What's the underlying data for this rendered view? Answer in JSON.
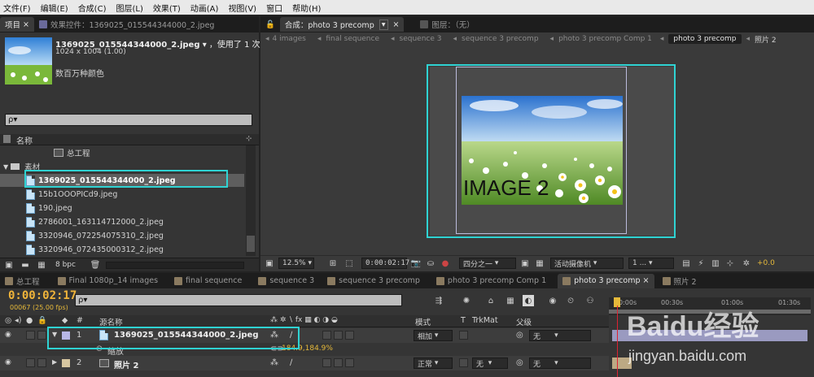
{
  "menu": [
    "文件(F)",
    "编辑(E)",
    "合成(C)",
    "图层(L)",
    "效果(T)",
    "动画(A)",
    "视图(V)",
    "窗口",
    "帮助(H)"
  ],
  "left_tabs": {
    "project": "项目",
    "close": "×",
    "effects": "效果控件：1369025_015544344000_2.jpeg"
  },
  "project": {
    "asset_name": "1369025_015544344000_2.jpeg",
    "dropdown": "▾",
    "used": "，使用了 1 次",
    "dims": "1024 x 1004 (1.00)",
    "colors": "数百万种颜色",
    "search_placeholder": "ρ▾",
    "col_name": "名称",
    "items": [
      {
        "label": "总工程",
        "type": "comp"
      },
      {
        "label": "素材",
        "type": "folder"
      },
      {
        "label": "1369025_015544344000_2.jpeg",
        "type": "file"
      },
      {
        "label": "15b1OOOPICd9.jpeg",
        "type": "file"
      },
      {
        "label": "190.jpeg",
        "type": "file"
      },
      {
        "label": "2786001_163114712000_2.jpeg",
        "type": "file"
      },
      {
        "label": "3320946_072254075310_2.jpeg",
        "type": "file"
      },
      {
        "label": "3320946_072435000312_2.jpeg",
        "type": "file"
      }
    ],
    "bpc": "8 bpc"
  },
  "viewer": {
    "comp_tab": "合成：photo 3 precomp",
    "layer_tab": "图层：（无）",
    "breadcrumbs": [
      "4 images",
      "final sequence",
      "sequence 3",
      "sequence 3 precomp",
      "photo 3 precomp Comp 1",
      "photo 3 precomp",
      "照片 2"
    ],
    "image_text": "IMAGE 2",
    "zoom": "12.5%",
    "timecode": "0:00:02:17",
    "quality": "四分之一",
    "camera": "活动摄像机",
    "views": "1 ...",
    "exposure": "+0.0"
  },
  "timeline": {
    "tabs": [
      "总工程",
      "Final 1080p_14 images",
      "final sequence",
      "sequence 3",
      "sequence 3 precomp",
      "photo 3 precomp Comp 1",
      "photo 3 precomp",
      "照片 2"
    ],
    "tab_colors": [
      "#8a7a60",
      "#8a7a60",
      "#8a7a60",
      "#8a7a60",
      "#8a7a60",
      "#8a7a60",
      "#8a7a60",
      "#8a7a60"
    ],
    "timecode": "0:00:02:17",
    "frames": "00067 (25.00 fps)",
    "search_placeholder": "ρ▾",
    "headers": {
      "num": "#",
      "source": "源名称",
      "mode": "模式",
      "t": "T",
      "trkmat": "TrkMat",
      "parent": "父级"
    },
    "ruler": [
      "0:00s",
      "00:30s",
      "01:00s",
      "01:30s"
    ],
    "layers": [
      {
        "num": "1",
        "name": "1369025_015544344000_2.jpeg",
        "mode": "相加",
        "trkmat": "",
        "parent": "无"
      },
      {
        "num": "2",
        "name": "照片 2",
        "mode": "正常",
        "trkmat": "无",
        "parent": "无"
      }
    ],
    "scale_label": "缩放",
    "scale_value": "184.9,184.9%"
  },
  "watermark": {
    "brand": "Baidu经验",
    "url": "jingyan.baidu.com"
  }
}
